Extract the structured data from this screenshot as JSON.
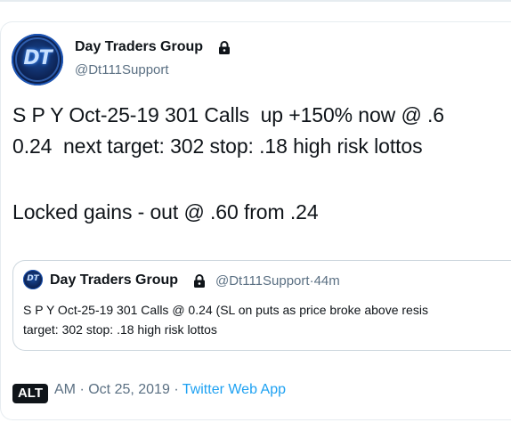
{
  "tweet": {
    "author": {
      "display_name": "Day Traders Group",
      "handle": "@Dt111Support",
      "avatar_label": "DT",
      "protected_icon": "lock-icon"
    },
    "text_lines": [
      "S P Y Oct-25-19 301 Calls  up +150% now @ .6",
      "0.24  next target: 302 stop: .18 high risk lottos",
      "Locked gains - out @ .60 from .24"
    ],
    "quoted_tweet": {
      "display_name": "Day Traders Group",
      "protected_icon": "lock-icon",
      "handle": "@Dt111Support",
      "separator": "·",
      "time_ago": "44m",
      "avatar_label": "DT",
      "text_lines": [
        "S P Y Oct-25-19 301 Calls @ 0.24 (SL on puts as price broke above resis",
        "target: 302 stop: .18 high risk lottos"
      ]
    },
    "footer": {
      "alt_label": "ALT",
      "time": "AM",
      "separator1": "·",
      "date": "Oct 25, 2019",
      "separator2": "·",
      "source": "Twitter Web App"
    }
  },
  "colors": {
    "text": "#0f1419",
    "secondary": "#5b7083",
    "link": "#1da1f2",
    "border": "#ccd6dd"
  }
}
